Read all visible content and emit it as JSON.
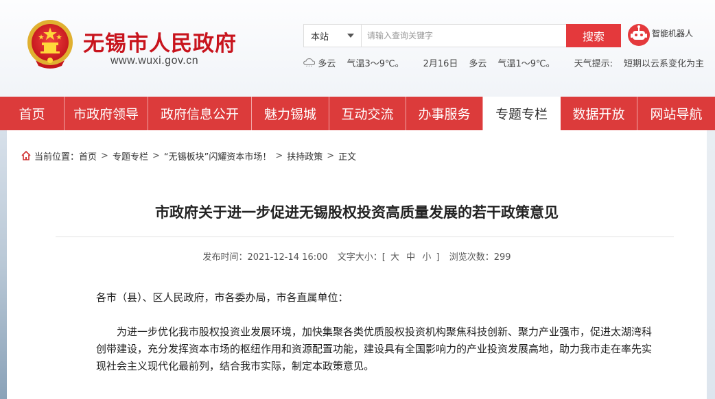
{
  "site": {
    "name": "无锡市人民政府",
    "url": "www.wuxi.gov.cn"
  },
  "search": {
    "scope": "本站",
    "placeholder": "请输入查询关键字",
    "button": "搜索"
  },
  "robot": {
    "label": "智能机器人",
    "icon": "robot-icon"
  },
  "weather": {
    "today_desc": "多云",
    "today_temp": "气温3～9℃。",
    "tomorrow_date": "2月16日",
    "tomorrow_desc": "多云",
    "tomorrow_temp": "气温1～9℃。",
    "tip_label": "天气提示:",
    "tip_text": "短期以云系变化为主"
  },
  "nav": {
    "items": [
      {
        "label": "首页"
      },
      {
        "label": "市政府领导"
      },
      {
        "label": "政府信息公开"
      },
      {
        "label": "魅力锡城"
      },
      {
        "label": "互动交流"
      },
      {
        "label": "办事服务"
      },
      {
        "label": "专题专栏"
      },
      {
        "label": "数据开放"
      },
      {
        "label": "网站导航"
      }
    ],
    "active_index": 6
  },
  "breadcrumb": {
    "prefix": "当前位置：",
    "items": [
      "首页",
      "专题专栏",
      "“无锡板块”闪耀资本市场！",
      "扶持政策",
      "正文"
    ],
    "separator": ">"
  },
  "article": {
    "title": "市政府关于进一步促进无锡股权投资高质量发展的若干政策意见",
    "publish_label": "发布时间：",
    "publish_time": "2021-12-14 16:00",
    "fontsize_label": "文字大小：[",
    "fontsize_large": "大",
    "fontsize_medium": "中",
    "fontsize_small": "小",
    "fontsize_close": "]",
    "views_label": "浏览次数：",
    "views": "299",
    "salutation": "各市（县）、区人民政府，市各委办局，市各直属单位：",
    "paragraph1": "　　为进一步优化我市股权投资业发展环境，加快集聚各类优质股权投资机构聚焦科技创新、聚力产业强市，促进太湖湾科创带建设，充分发挥资本市场的枢纽作用和资源配置功能，建设具有全国影响力的产业投资发展高地，助力我市走在率先实现社会主义现代化最前列，结合我市实际，制定本政策意见。"
  },
  "colors": {
    "brand_red": "#c8141d",
    "nav_red": "#dc3b3b",
    "search_red": "#e4393c"
  }
}
